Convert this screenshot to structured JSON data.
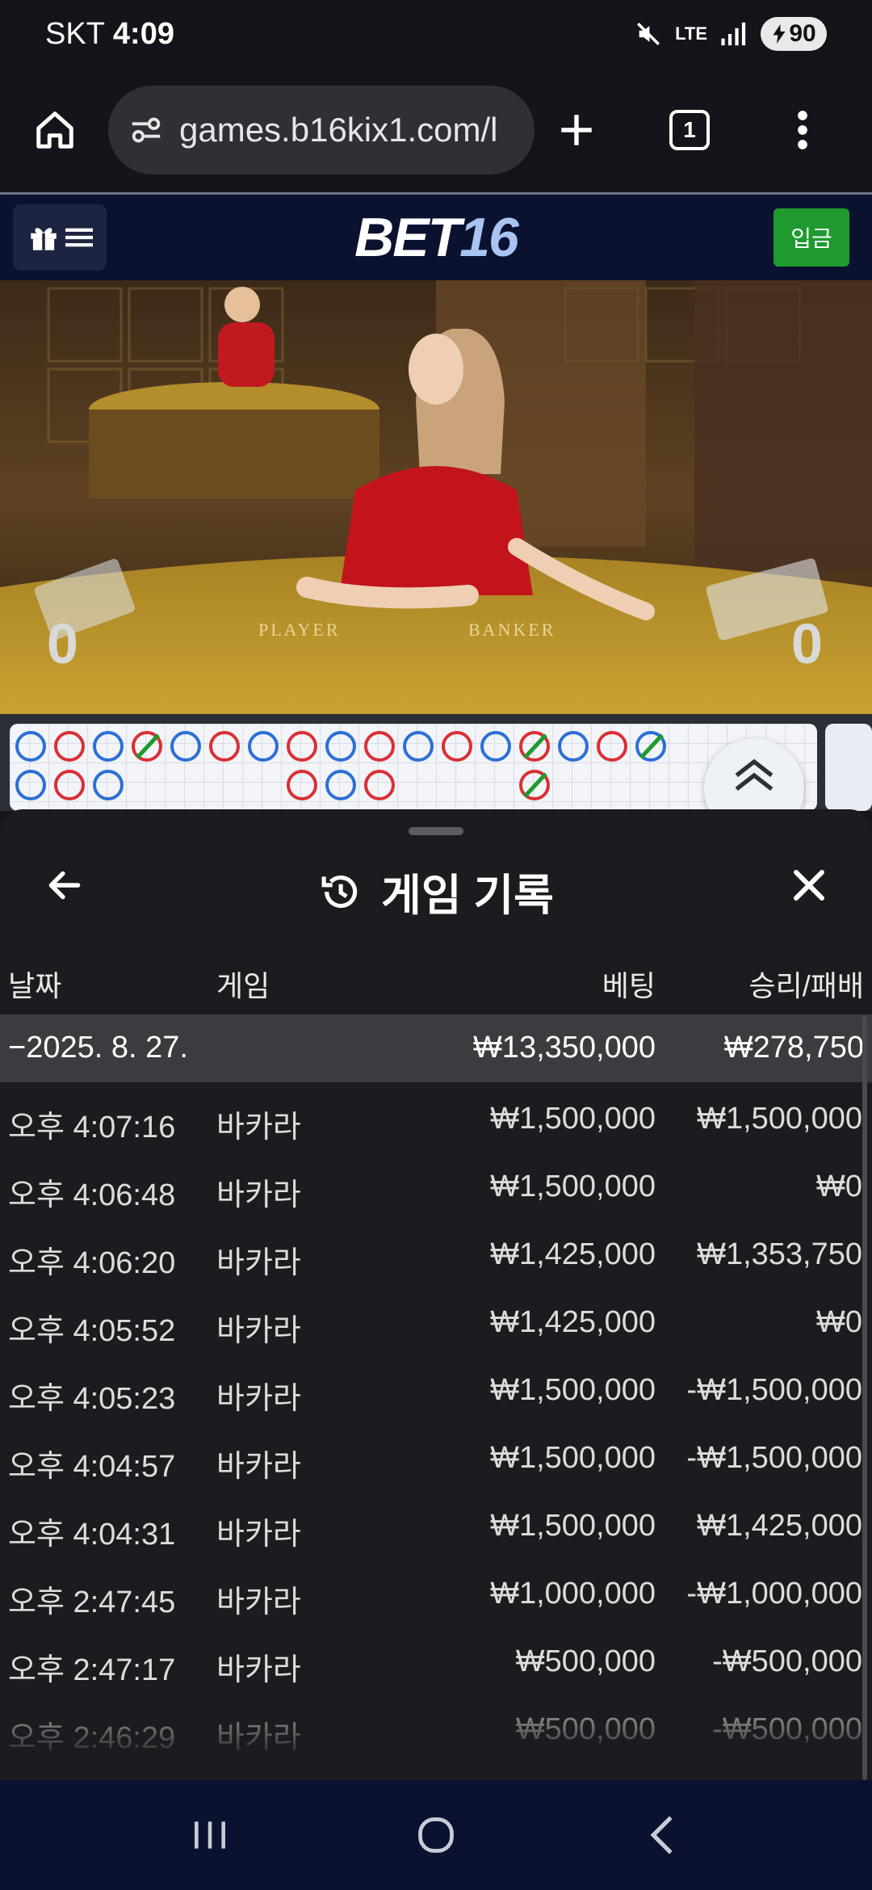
{
  "status_bar": {
    "carrier": "SKT",
    "time": "4:09",
    "network": "LTE",
    "battery": "90"
  },
  "browser": {
    "url": "games.b16kix1.com/l",
    "tab_count": "1"
  },
  "site": {
    "logo_part1": "BET",
    "logo_part2": "16",
    "deposit_label": "입금",
    "accent": "#1f9a2e"
  },
  "video": {
    "player_score": "0",
    "banker_score": "0"
  },
  "history": {
    "title": "게임 기록",
    "columns": {
      "date": "날짜",
      "game": "게임",
      "bet": "베팅",
      "winloss": "승리/패배"
    },
    "group": {
      "date": "−2025. 8. 27.",
      "bet": "₩13,350,000",
      "winloss": "₩278,750"
    },
    "rows": [
      {
        "time": "오후 4:07:16",
        "game": "바카라",
        "bet": "₩1,500,000",
        "winloss": "₩1,500,000"
      },
      {
        "time": "오후 4:06:48",
        "game": "바카라",
        "bet": "₩1,500,000",
        "winloss": "₩0"
      },
      {
        "time": "오후 4:06:20",
        "game": "바카라",
        "bet": "₩1,425,000",
        "winloss": "₩1,353,750"
      },
      {
        "time": "오후 4:05:52",
        "game": "바카라",
        "bet": "₩1,425,000",
        "winloss": "₩0"
      },
      {
        "time": "오후 4:05:23",
        "game": "바카라",
        "bet": "₩1,500,000",
        "winloss": "-₩1,500,000"
      },
      {
        "time": "오후 4:04:57",
        "game": "바카라",
        "bet": "₩1,500,000",
        "winloss": "-₩1,500,000"
      },
      {
        "time": "오후 4:04:31",
        "game": "바카라",
        "bet": "₩1,500,000",
        "winloss": "₩1,425,000"
      },
      {
        "time": "오후 2:47:45",
        "game": "바카라",
        "bet": "₩1,000,000",
        "winloss": "-₩1,000,000"
      },
      {
        "time": "오후 2:47:17",
        "game": "바카라",
        "bet": "₩500,000",
        "winloss": "-₩500,000"
      },
      {
        "time": "오후 2:46:29",
        "game": "바카라",
        "bet": "₩500,000",
        "winloss": "-₩500,000"
      }
    ]
  }
}
